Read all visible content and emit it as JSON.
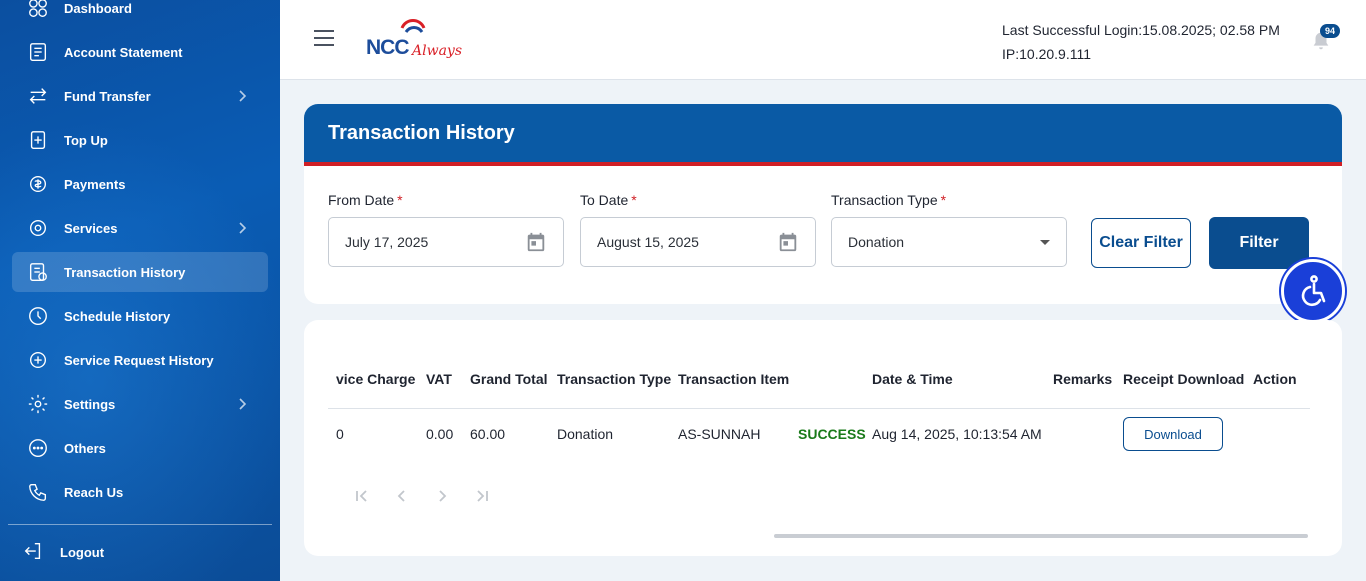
{
  "sidebar": {
    "items": [
      {
        "label": "Dashboard",
        "icon": "dashboard-icon",
        "active": false,
        "chevron": false
      },
      {
        "label": "Account Statement",
        "icon": "statement-icon",
        "active": false,
        "chevron": false
      },
      {
        "label": "Fund Transfer",
        "icon": "transfer-icon",
        "active": false,
        "chevron": true
      },
      {
        "label": "Top Up",
        "icon": "topup-icon",
        "active": false,
        "chevron": false
      },
      {
        "label": "Payments",
        "icon": "payments-icon",
        "active": false,
        "chevron": false
      },
      {
        "label": "Services",
        "icon": "services-icon",
        "active": false,
        "chevron": true
      },
      {
        "label": "Transaction History",
        "icon": "history-icon",
        "active": true,
        "chevron": false
      },
      {
        "label": "Schedule History",
        "icon": "clock-icon",
        "active": false,
        "chevron": false
      },
      {
        "label": "Service Request History",
        "icon": "request-icon",
        "active": false,
        "chevron": false
      },
      {
        "label": "Settings",
        "icon": "gear-icon",
        "active": false,
        "chevron": true
      },
      {
        "label": "Others",
        "icon": "more-icon",
        "active": false,
        "chevron": false
      },
      {
        "label": "Reach Us",
        "icon": "phone-icon",
        "active": false,
        "chevron": false
      }
    ],
    "logout_label": "Logout"
  },
  "header": {
    "logo_text": "NCC",
    "logo_script": "Always",
    "last_login": "Last Successful Login:15.08.2025; 02.58 PM",
    "ip": "IP:10.20.9.111",
    "notification_count": "94"
  },
  "filter": {
    "title": "Transaction History",
    "from_label": "From Date",
    "from_value": "July 17, 2025",
    "to_label": "To Date",
    "to_value": "August 15, 2025",
    "type_label": "Transaction Type",
    "type_value": "Donation",
    "required_mark": "*",
    "clear_label": "Clear Filter",
    "filter_label": "Filter"
  },
  "table": {
    "headers": {
      "service_charge": "vice Charge",
      "vat": "VAT",
      "grand_total": "Grand Total",
      "type": "Transaction Type",
      "item": "Transaction Item",
      "datetime": "Date & Time",
      "remarks": "Remarks",
      "receipt": "Receipt Download",
      "action": "Action"
    },
    "rows": [
      {
        "service_charge": "0",
        "vat": "0.00",
        "grand_total": "60.00",
        "type": "Donation",
        "item": "AS-SUNNAH",
        "status": "SUCCESS",
        "datetime": "Aug 14, 2025, 10:13:54 AM",
        "remarks": "",
        "receipt_label": "Download"
      }
    ]
  },
  "colors": {
    "primary": "#0a4d8f",
    "header_blue": "#0a5aa5",
    "accent_red": "#d01f25",
    "success": "#1a7a1a"
  }
}
